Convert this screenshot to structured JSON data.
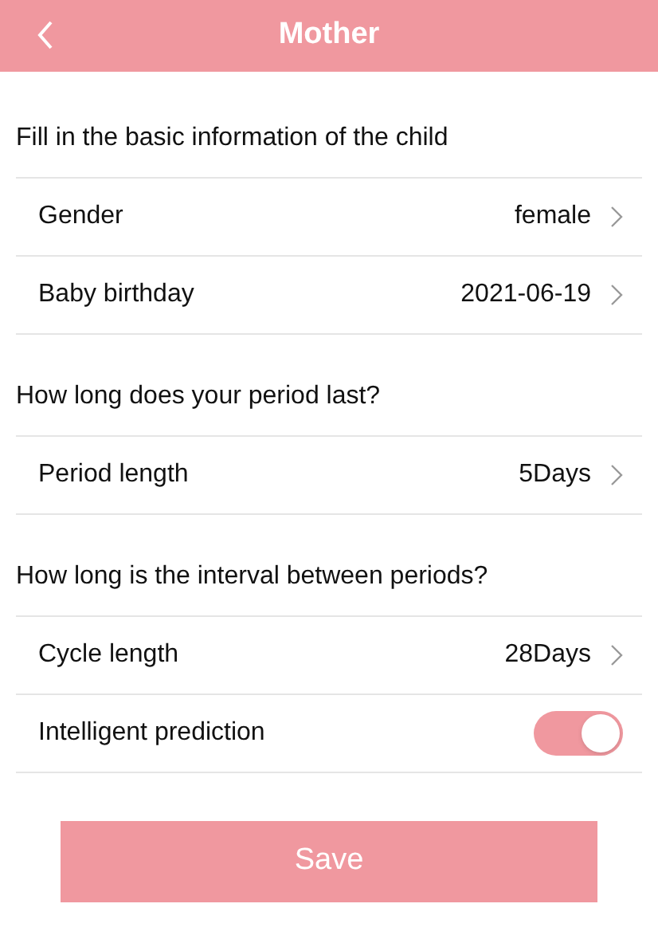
{
  "header": {
    "title": "Mother"
  },
  "sections": [
    {
      "heading": "Fill in the basic information of the child",
      "rows": [
        {
          "kind": "select",
          "label": "Gender",
          "value": "female"
        },
        {
          "kind": "select",
          "label": "Baby birthday",
          "value": "2021-06-19"
        }
      ]
    },
    {
      "heading": "How long does your period last?",
      "rows": [
        {
          "kind": "select",
          "label": "Period length",
          "value": "5Days"
        }
      ]
    },
    {
      "heading": "How long is the interval between periods?",
      "rows": [
        {
          "kind": "select",
          "label": "Cycle length",
          "value": "28Days"
        },
        {
          "kind": "toggle",
          "label": "Intelligent prediction",
          "on": true
        }
      ]
    }
  ],
  "save_button": {
    "label": "Save"
  }
}
